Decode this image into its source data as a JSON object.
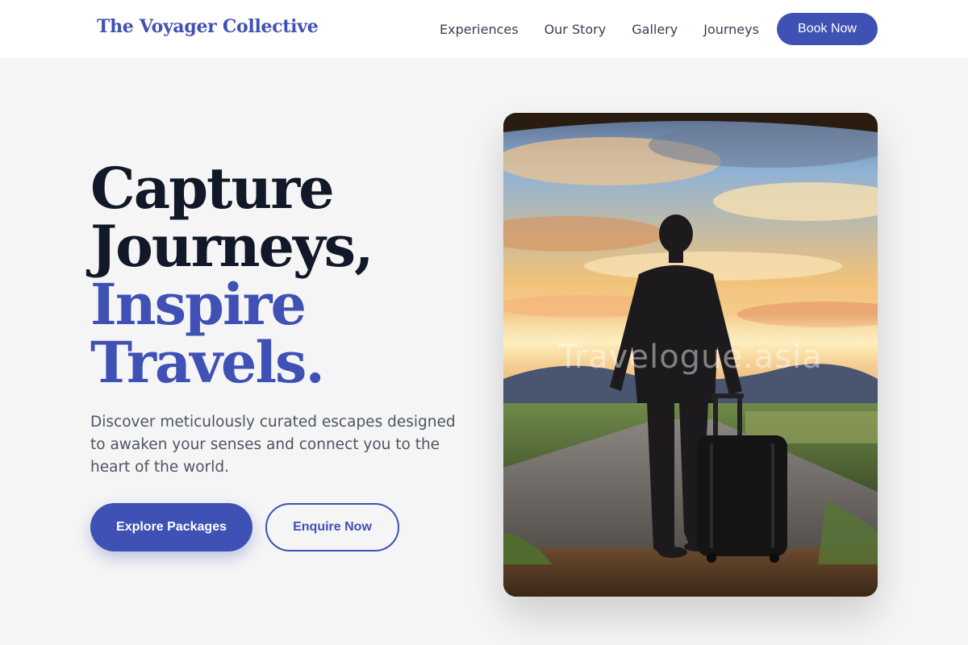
{
  "header": {
    "brand": "The Voyager Collective",
    "nav": [
      "Experiences",
      "Our Story",
      "Gallery",
      "Journeys"
    ],
    "cta": "Book Now"
  },
  "hero": {
    "headline_dark": [
      "Capture",
      "Journeys,"
    ],
    "headline_accent": [
      "Inspire",
      "Travels."
    ],
    "subtext": "Discover meticulously curated escapes designed to awaken your senses and connect you to the heart of the world.",
    "primary_button": "Explore Packages",
    "secondary_button": "Enquire Now",
    "image_watermark": "Travelogue.asia"
  },
  "colors": {
    "accent": "#3f51b5",
    "heading": "#111827",
    "background": "#f5f5f5"
  }
}
